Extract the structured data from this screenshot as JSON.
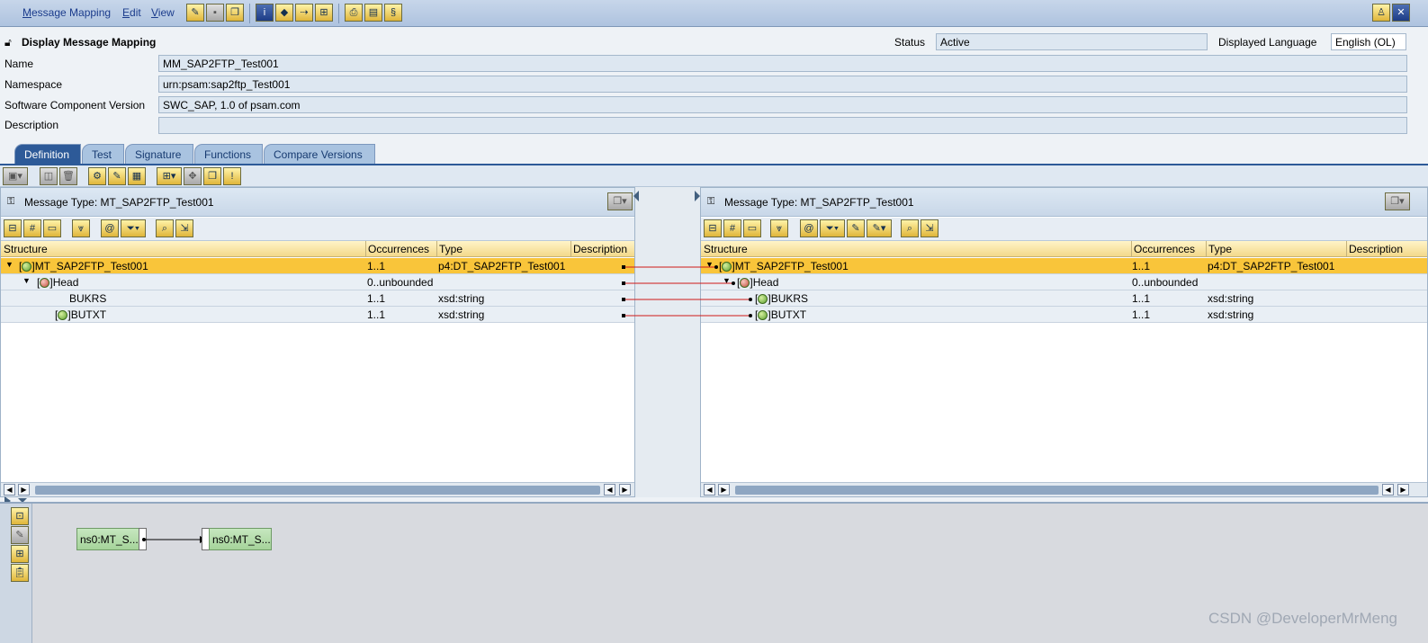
{
  "menu": {
    "items": [
      {
        "label_prefix": "M",
        "label_rest": "essage Mapping"
      },
      {
        "label_prefix": "E",
        "label_rest": "dit"
      },
      {
        "label_prefix": "V",
        "label_rest": "iew"
      }
    ]
  },
  "header": {
    "title": "Display Message Mapping",
    "status_label": "Status",
    "status_value": "Active",
    "language_label": "Displayed Language",
    "language_value": "English (OL)"
  },
  "form": {
    "name_label": "Name",
    "name_value": "MM_SAP2FTP_Test001",
    "namespace_label": "Namespace",
    "namespace_value": "urn:psam:sap2ftp_Test001",
    "swcv_label": "Software Component Version",
    "swcv_value": "SWC_SAP, 1.0 of psam.com",
    "description_label": "Description",
    "description_value": ""
  },
  "tabs": [
    {
      "label": "Definition",
      "active": true
    },
    {
      "label": "Test",
      "active": false
    },
    {
      "label": "Signature",
      "active": false
    },
    {
      "label": "Functions",
      "active": false
    },
    {
      "label": "Compare Versions",
      "active": false
    }
  ],
  "source_panel": {
    "title": "Message Type: MT_SAP2FTP_Test001",
    "columns": [
      "Structure",
      "Occurrences",
      "Type",
      "Description"
    ],
    "rows": [
      {
        "name": "MT_SAP2FTP_Test001",
        "occ": "1..1",
        "type": "p4:DT_SAP2FTP_Test001",
        "desc": ""
      },
      {
        "name": "Head",
        "occ": "0..unbounded",
        "type": "",
        "desc": ""
      },
      {
        "name": "BUKRS",
        "occ": "1..1",
        "type": "xsd:string",
        "desc": ""
      },
      {
        "name": "BUTXT",
        "occ": "1..1",
        "type": "xsd:string",
        "desc": ""
      }
    ]
  },
  "target_panel": {
    "title": "Message Type: MT_SAP2FTP_Test001",
    "columns": [
      "Structure",
      "Occurrences",
      "Type",
      "Description"
    ],
    "rows": [
      {
        "name": "MT_SAP2FTP_Test001",
        "occ": "1..1",
        "type": "p4:DT_SAP2FTP_Test001",
        "desc": ""
      },
      {
        "name": "Head",
        "occ": "0..unbounded",
        "type": "",
        "desc": ""
      },
      {
        "name": "BUKRS",
        "occ": "1..1",
        "type": "xsd:string",
        "desc": ""
      },
      {
        "name": "BUTXT",
        "occ": "1..1",
        "type": "xsd:string",
        "desc": ""
      }
    ]
  },
  "graph": {
    "source_node": "ns0:MT_S...",
    "target_node": "ns0:MT_S..."
  },
  "watermark": "CSDN @DeveloperMrMeng",
  "colors": {
    "selected_row": "#f9c53a",
    "mapping_line": "#d01818",
    "tab_active": "#2d5a98"
  }
}
